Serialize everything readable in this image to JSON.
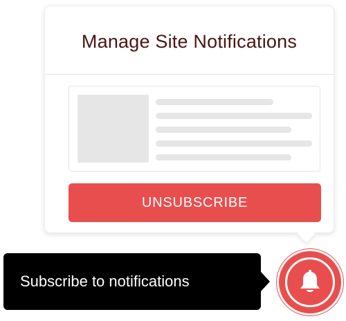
{
  "popup": {
    "title": "Manage Site Notifications",
    "unsubscribe_label": "UNSUBSCRIBE"
  },
  "tooltip": {
    "text": "Subscribe to notifications"
  },
  "bell": {
    "icon": "bell-icon"
  },
  "colors": {
    "accent": "#e94e4e",
    "title": "#4a1414",
    "tooltip_bg": "#000000",
    "placeholder": "#e6e6e6"
  }
}
